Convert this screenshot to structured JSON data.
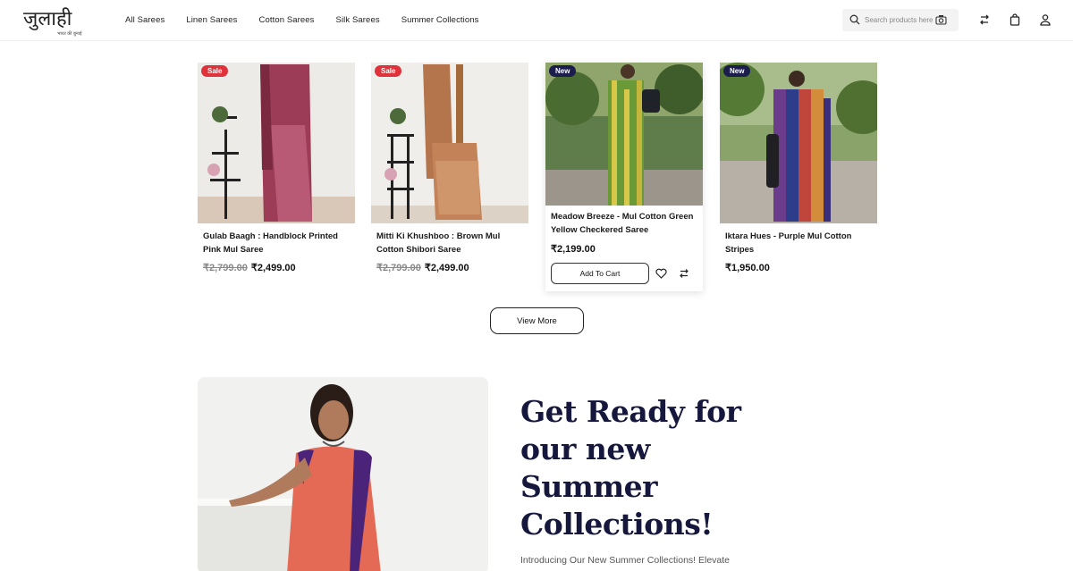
{
  "logo": {
    "text": "जुलाही",
    "tagline": "भारत की बुनाई"
  },
  "nav": [
    "All Sarees",
    "Linen Sarees",
    "Cotton Sarees",
    "Silk Sarees",
    "Summer Collections"
  ],
  "search": {
    "placeholder": "Search products here"
  },
  "products": [
    {
      "badge": "Sale",
      "name": "Gulab Baagh : Handblock Printed Pink Mul Saree",
      "old_price": "₹2,799.00",
      "price": "₹2,499.00"
    },
    {
      "badge": "Sale",
      "name": "Mitti Ki Khushboo : Brown Mul Cotton Shibori Saree",
      "old_price": "₹2,799.00",
      "price": "₹2,499.00"
    },
    {
      "badge": "New",
      "name": "Meadow Breeze - Mul Cotton Green Yellow Checkered Saree",
      "price": "₹2,199.00",
      "add_to_cart": "Add To Cart"
    },
    {
      "badge": "New",
      "name": "Iktara Hues - Purple Mul Cotton Stripes",
      "price": "₹1,950.00"
    }
  ],
  "view_more": "View More",
  "promo": {
    "title": "Get Ready for our new Summer Collections!",
    "text": "Introducing Our New Summer Collections! Elevate"
  },
  "colors": {
    "sale": "#e0323a",
    "new": "#1b1d4d",
    "title": "#15173d"
  },
  "icons": [
    "search-icon",
    "camera-icon",
    "compare-icon",
    "bag-icon",
    "user-icon",
    "heart-icon"
  ]
}
